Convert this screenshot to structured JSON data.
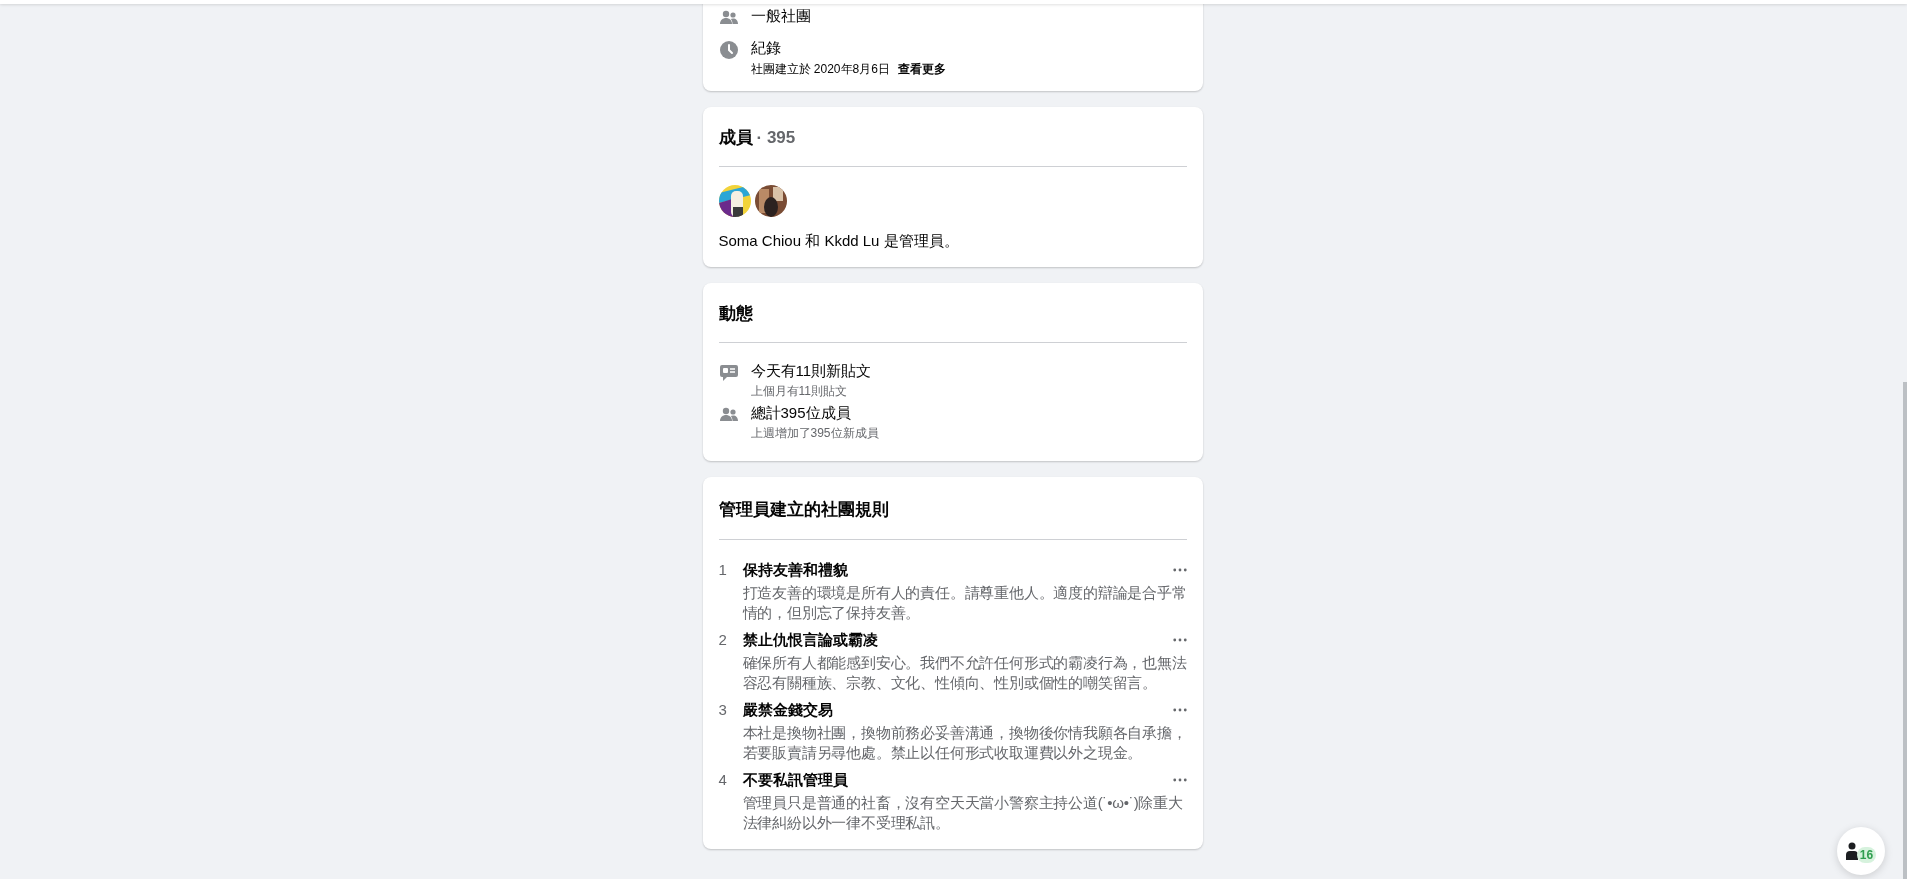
{
  "about_card": {
    "items": [
      {
        "kind": "group_type",
        "title": "一般社團"
      },
      {
        "kind": "history",
        "title": "紀錄",
        "detail": "社團建立於 2020年8月6日",
        "link": "查看更多"
      }
    ]
  },
  "members_card": {
    "title": "成員",
    "count": "· 395",
    "admins_text": "Soma Chiou 和 Kkdd Lu 是管理員。"
  },
  "activity_card": {
    "title": "動態",
    "items": [
      {
        "kind": "posts",
        "title": "今天有11則新貼文",
        "detail": "上個月有11則貼文"
      },
      {
        "kind": "members",
        "title": "總計395位成員",
        "detail": "上週增加了395位新成員"
      }
    ]
  },
  "rules_card": {
    "title": "管理員建立的社團規則",
    "rules": [
      {
        "number": "1",
        "title": "保持友善和禮貌",
        "description": "打造友善的環境是所有人的責任。請尊重他人。適度的辯論是合乎常情的，但別忘了保持友善。"
      },
      {
        "number": "2",
        "title": "禁止仇恨言論或霸凌",
        "description": "確保所有人都能感到安心。我們不允許任何形式的霸凌行為，也無法容忍有關種族、宗教、文化、性傾向、性別或個性的嘲笑留言。"
      },
      {
        "number": "3",
        "title": "嚴禁金錢交易",
        "description": "本社是換物社團，換物前務必妥善溝通，換物後你情我願各自承擔，若要販賣請另尋他處。禁止以任何形式收取運費以外之現金。"
      },
      {
        "number": "4",
        "title": "不要私訊管理員",
        "description": "管理員只是普通的社畜，沒有空天天當小警察主持公道(˙•ω•˙)除重大法律糾紛以外一律不受理私訊。"
      }
    ]
  },
  "contacts_button": {
    "badge": "16"
  }
}
